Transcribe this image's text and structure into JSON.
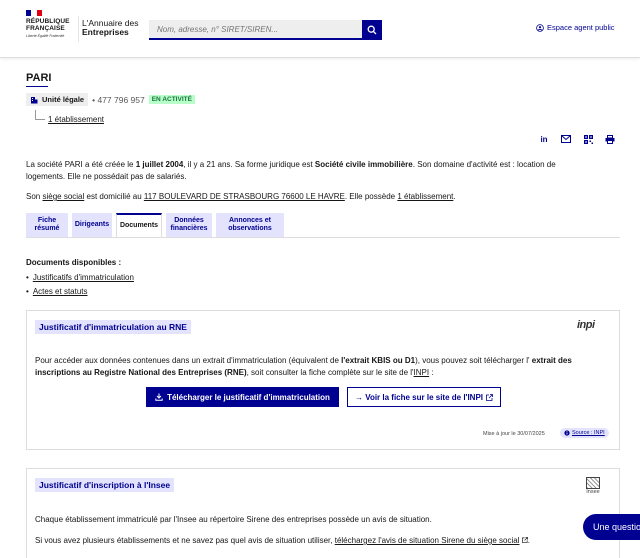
{
  "header": {
    "rf_line1": "RÉPUBLIQUE",
    "rf_line2": "FRANÇAISE",
    "rf_motto": "Liberté Égalité Fraternité",
    "brand_prefix": "L'Annuaire",
    "brand_suffix": "des",
    "brand_line2": "Entreprises",
    "search_placeholder": "Nom, adresse, n° SIRET/SIREN...",
    "agent_link": "Espace agent public",
    "colors": {
      "blue": "#000091",
      "red": "#e1000f"
    }
  },
  "company": {
    "name": "PARI",
    "unit_type": "Unité légale",
    "siren": "• 477 796 957",
    "status": "EN ACTIVITÉ",
    "etablissements_link": "1 établissement",
    "desc_p1": "La société PARI a été créée le ",
    "desc_date": "1 juillet 2004",
    "desc_p2": ", il y a 21 ans. Sa forme juridique est ",
    "desc_forme": "Société civile immobilière",
    "desc_p3": ". Son domaine d'activité est : location de logements. Elle ne possédait pas de salariés.",
    "addr_p1": "Son ",
    "addr_siege": "siège social",
    "addr_p2": " est domicilié au ",
    "addr_value": "117 BOULEVARD DE STRASBOURG 76600 LE HAVRE",
    "addr_p3": ". Elle possède ",
    "addr_etab": "1 établissement",
    "addr_p4": "."
  },
  "share": [
    "in",
    "mail",
    "qr",
    "print"
  ],
  "tabs": [
    {
      "label": "Fiche résumé"
    },
    {
      "label": "Dirigeants"
    },
    {
      "label": "Documents"
    },
    {
      "label": "Données financières"
    },
    {
      "label": "Annonces et observations"
    }
  ],
  "documents": {
    "title": "Documents disponibles :",
    "items": [
      "Justificatifs d'immatriculation",
      "Actes et statuts"
    ]
  },
  "rne": {
    "title": "Justificatif d'immatriculation au RNE",
    "logo": "inpi",
    "p1": "Pour accéder aux données contenues dans un extrait d'immatriculation (équivalent de ",
    "p_kbis": "l'extrait KBIS ou D1",
    "p2": "), vous pouvez soit télécharger l' ",
    "p_extrait": "extrait des inscriptions au Registre National des Entreprises (RNE)",
    "p3": ", soit consulter la fiche complète sur le site de l'",
    "p_inpi": "INPI",
    "p4": " :",
    "btn_download": "Télécharger le justificatif d'immatriculation",
    "btn_inpi": "→ Voir la fiche sur le site de l'INPI",
    "maj": "Mise à jour le 30/07/2025",
    "source": "Source : INPI"
  },
  "insee": {
    "title": "Justificatif d'inscription à l'Insee",
    "logo": "Insee",
    "p1": "Chaque établissement immatriculé par l'Insee au répertoire Sirene des entreprises possède un avis de situation.",
    "p2a": "Si vous avez plusieurs établissements et ne savez pas quel avis de situation utiliser, ",
    "p2_link": "téléchargez l'avis de situation Sirene du siège social",
    "p2b": "."
  },
  "question_button": "Une question"
}
